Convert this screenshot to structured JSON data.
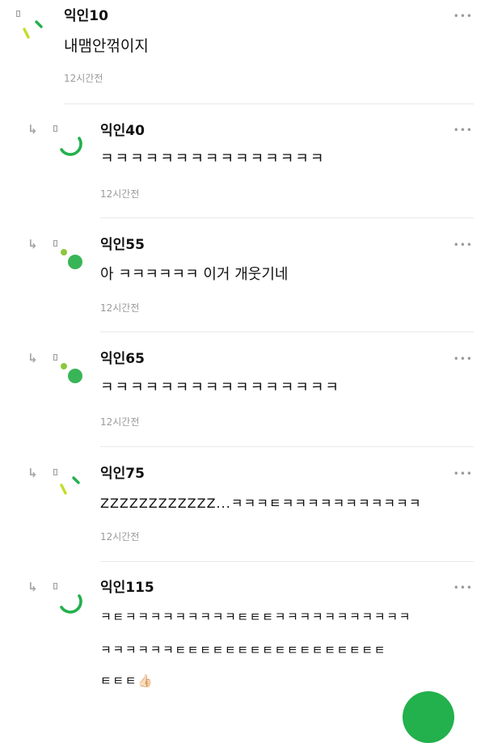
{
  "more_icon_glyph": "•••",
  "reply_arrow_glyph": "↳",
  "accent_colors": {
    "green": "#22b14c",
    "lime": "#8dc63f",
    "yellow_green": "#c6dc2a",
    "divider": "#e8e8e8",
    "meta_gray": "#9a9a9a"
  },
  "comments": [
    {
      "author": "익인10",
      "avatar": "tick-lines-avatar",
      "lines": [
        "내맴안꺾이지"
      ],
      "time": "12시간전",
      "is_reply": false
    },
    {
      "author": "익인40",
      "avatar": "green-arc-avatar",
      "lines": [
        "ㅋㅋㅋㅋㅋㅋㅋㅋㅋㅋㅋㅋㅋㅋㅋ"
      ],
      "time": "12시간전",
      "is_reply": true
    },
    {
      "author": "익인55",
      "avatar": "dot-circle-avatar",
      "lines": [
        "아 ㅋㅋㅋㅋㅋㅋ 이거 개웃기네"
      ],
      "time": "12시간전",
      "is_reply": true
    },
    {
      "author": "익인65",
      "avatar": "dot-circle-avatar",
      "lines": [
        "ㅋㅋㅋㅋㅋㅋㅋㅋㅋㅋㅋㅋㅋㅋㅋㅋ"
      ],
      "time": "12시간전",
      "is_reply": true
    },
    {
      "author": "익인75",
      "avatar": "tick-lines-avatar",
      "lines": [
        "ZZZZZZZZZZZZ...ㅋㅋㅋㅌㅋㅋㅋㅋㅋㅋㅋㅋㅋㅋㅋ"
      ],
      "time": "12시간전",
      "is_reply": true
    },
    {
      "author": "익인115",
      "avatar": "green-arc-avatar",
      "lines": [
        "ㅋㅌㅋㅋㅋㅋㅋㅋㅋㅋㅋㅌㅌㅌㅋㅋㅋㅋㅋㅋㅋㅋㅋㅋㅋ",
        "ㅋㅋㅋㅋㅋㅋㅌㅌㅌㅌㅌㅌㅌㅌㅌㅌㅌㅌㅌㅌㅌㅌㅌ",
        "ㅌㅌㅌ👍🏻"
      ],
      "time": null,
      "is_reply": true
    }
  ]
}
